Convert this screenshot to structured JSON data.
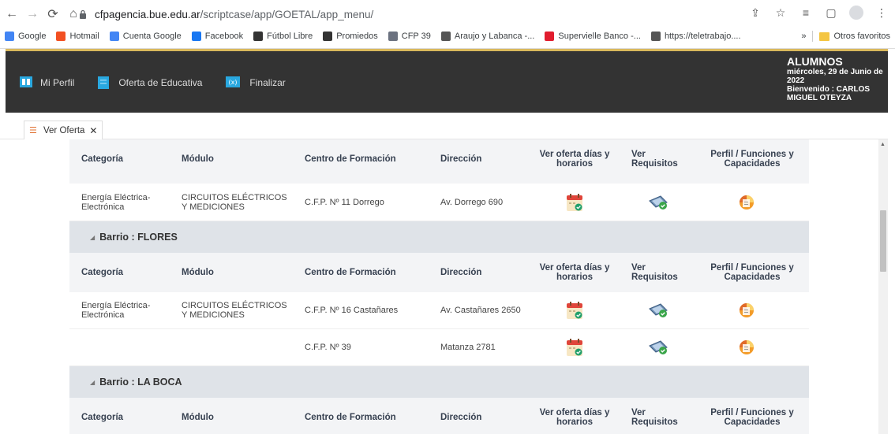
{
  "browser": {
    "url_host": "cfpagencia.bue.edu.ar",
    "url_path": "/scriptcase/app/GOETAL/app_menu/",
    "bookmarks": [
      {
        "label": "Google",
        "color": "#4285f4"
      },
      {
        "label": "Hotmail",
        "color": "#f25022"
      },
      {
        "label": "Cuenta Google",
        "color": "#4285f4"
      },
      {
        "label": "Facebook",
        "color": "#1877f2"
      },
      {
        "label": "Fútbol Libre",
        "color": "#333333"
      },
      {
        "label": "Promiedos",
        "color": "#333333"
      },
      {
        "label": "CFP 39",
        "color": "#6b7280"
      },
      {
        "label": "Araujo y Labanca -...",
        "color": "#555555"
      },
      {
        "label": "Supervielle Banco -...",
        "color": "#e11d2e"
      },
      {
        "label": "https://teletrabajo....",
        "color": "#555555"
      }
    ],
    "more": "»",
    "other_bookmarks": "Otros favoritos"
  },
  "header": {
    "menu": [
      {
        "label": "Mi Perfil",
        "icon": "profile-icon"
      },
      {
        "label": "Oferta de Educativa",
        "icon": "document-icon"
      },
      {
        "label": "Finalizar",
        "icon": "exit-icon"
      }
    ],
    "user": {
      "role": "ALUMNOS",
      "date": "miércoles, 29 de Junio de 2022",
      "welcome": "Bienvenido : CARLOS MIGUEL OTEYZA"
    }
  },
  "tab": {
    "label": "Ver Oferta",
    "close": "✕"
  },
  "table": {
    "columns": [
      "Categoría",
      "Módulo",
      "Centro de Formación",
      "Dirección",
      "Ver oferta días y horarios",
      "Ver Requisitos",
      "Perfil / Funciones y Capacidades"
    ],
    "top_row": {
      "categoria": "Energía Eléctrica-Electrónica",
      "modulo": "CIRCUITOS ELÉCTRICOS Y MEDICIONES",
      "centro": "C.F.P. Nº 11 Dorrego",
      "direccion": "Av. Dorrego 690"
    },
    "groups": [
      {
        "label": "Barrio : FLORES",
        "rows": [
          {
            "categoria": "Energía Eléctrica-Electrónica",
            "modulo": "CIRCUITOS ELÉCTRICOS Y MEDICIONES",
            "centro": "C.F.P. Nº 16 Castañares",
            "direccion": "Av. Castañares 2650"
          },
          {
            "categoria": "",
            "modulo": "",
            "centro": "C.F.P. Nº 39",
            "direccion": "Matanza 2781"
          }
        ]
      },
      {
        "label": "Barrio : LA BOCA",
        "rows": []
      }
    ]
  }
}
